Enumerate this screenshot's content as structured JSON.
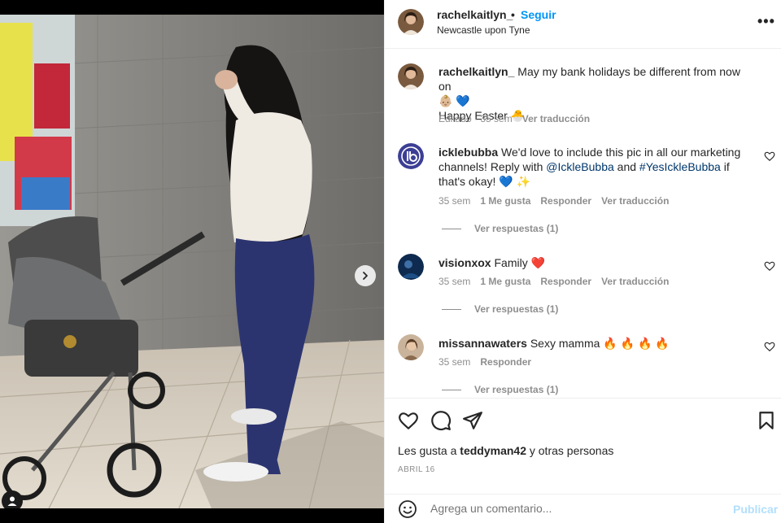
{
  "post": {
    "username": "rachelkaitlyn_",
    "separator": "•",
    "follow_label": "Seguir",
    "location": "Newcastle upon Tyne",
    "more_label": "•••"
  },
  "caption": {
    "username": "rachelkaitlyn_",
    "line1": "May my bank holidays be different from now on",
    "line2": "👶🏼 💙",
    "line3": "Happy Easter 🐣",
    "edited": "Editado",
    "time": "35 sem",
    "translate": "Ver traducción"
  },
  "comments": [
    {
      "username": "icklebubba",
      "text_a": "We'd love to include this pic in all our marketing channels! Reply with ",
      "mention1": "@IckleBubba",
      "text_b": " and ",
      "mention2": "#YesIckleBubba",
      "text_c": " if that's okay! 💙 ✨",
      "time": "35 sem",
      "likes": "1 Me gusta",
      "reply": "Responder",
      "translate": "Ver traducción",
      "replies": "Ver respuestas (1)"
    },
    {
      "username": "visionxox",
      "text": "Family ❤️",
      "time": "35 sem",
      "likes": "1 Me gusta",
      "reply": "Responder",
      "translate": "Ver traducción",
      "replies": "Ver respuestas (1)"
    },
    {
      "username": "missannawaters",
      "text": "Sexy mamma 🔥 🔥 🔥 🔥",
      "time": "35 sem",
      "reply": "Responder",
      "replies": "Ver respuestas (1)"
    }
  ],
  "likes_line": {
    "prefix": "Les gusta a",
    "user": "teddyman42",
    "suffix": "y otras personas"
  },
  "date": "ABRIL 16",
  "add_comment": {
    "placeholder": "Agrega un comentario...",
    "publish": "Publicar"
  },
  "icons": {
    "like": "heart-icon",
    "comment": "comment-icon",
    "share": "paper-plane-icon",
    "save": "bookmark-icon",
    "emoji": "smiley-icon",
    "next": "chevron-right-icon",
    "tagged": "person-tag-icon"
  },
  "colors": {
    "accent": "#0095f6",
    "muted": "#8e8e8e",
    "publish_disabled": "#b2dffc",
    "mention": "#00376b"
  }
}
